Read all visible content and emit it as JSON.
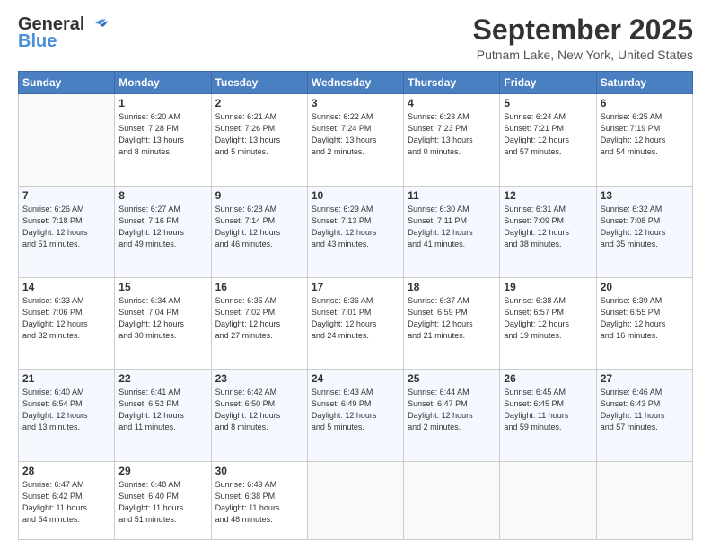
{
  "header": {
    "logo_general": "General",
    "logo_blue": "Blue",
    "month_title": "September 2025",
    "location": "Putnam Lake, New York, United States"
  },
  "weekdays": [
    "Sunday",
    "Monday",
    "Tuesday",
    "Wednesday",
    "Thursday",
    "Friday",
    "Saturday"
  ],
  "weeks": [
    [
      {
        "day": "",
        "info": ""
      },
      {
        "day": "1",
        "info": "Sunrise: 6:20 AM\nSunset: 7:28 PM\nDaylight: 13 hours\nand 8 minutes."
      },
      {
        "day": "2",
        "info": "Sunrise: 6:21 AM\nSunset: 7:26 PM\nDaylight: 13 hours\nand 5 minutes."
      },
      {
        "day": "3",
        "info": "Sunrise: 6:22 AM\nSunset: 7:24 PM\nDaylight: 13 hours\nand 2 minutes."
      },
      {
        "day": "4",
        "info": "Sunrise: 6:23 AM\nSunset: 7:23 PM\nDaylight: 13 hours\nand 0 minutes."
      },
      {
        "day": "5",
        "info": "Sunrise: 6:24 AM\nSunset: 7:21 PM\nDaylight: 12 hours\nand 57 minutes."
      },
      {
        "day": "6",
        "info": "Sunrise: 6:25 AM\nSunset: 7:19 PM\nDaylight: 12 hours\nand 54 minutes."
      }
    ],
    [
      {
        "day": "7",
        "info": "Sunrise: 6:26 AM\nSunset: 7:18 PM\nDaylight: 12 hours\nand 51 minutes."
      },
      {
        "day": "8",
        "info": "Sunrise: 6:27 AM\nSunset: 7:16 PM\nDaylight: 12 hours\nand 49 minutes."
      },
      {
        "day": "9",
        "info": "Sunrise: 6:28 AM\nSunset: 7:14 PM\nDaylight: 12 hours\nand 46 minutes."
      },
      {
        "day": "10",
        "info": "Sunrise: 6:29 AM\nSunset: 7:13 PM\nDaylight: 12 hours\nand 43 minutes."
      },
      {
        "day": "11",
        "info": "Sunrise: 6:30 AM\nSunset: 7:11 PM\nDaylight: 12 hours\nand 41 minutes."
      },
      {
        "day": "12",
        "info": "Sunrise: 6:31 AM\nSunset: 7:09 PM\nDaylight: 12 hours\nand 38 minutes."
      },
      {
        "day": "13",
        "info": "Sunrise: 6:32 AM\nSunset: 7:08 PM\nDaylight: 12 hours\nand 35 minutes."
      }
    ],
    [
      {
        "day": "14",
        "info": "Sunrise: 6:33 AM\nSunset: 7:06 PM\nDaylight: 12 hours\nand 32 minutes."
      },
      {
        "day": "15",
        "info": "Sunrise: 6:34 AM\nSunset: 7:04 PM\nDaylight: 12 hours\nand 30 minutes."
      },
      {
        "day": "16",
        "info": "Sunrise: 6:35 AM\nSunset: 7:02 PM\nDaylight: 12 hours\nand 27 minutes."
      },
      {
        "day": "17",
        "info": "Sunrise: 6:36 AM\nSunset: 7:01 PM\nDaylight: 12 hours\nand 24 minutes."
      },
      {
        "day": "18",
        "info": "Sunrise: 6:37 AM\nSunset: 6:59 PM\nDaylight: 12 hours\nand 21 minutes."
      },
      {
        "day": "19",
        "info": "Sunrise: 6:38 AM\nSunset: 6:57 PM\nDaylight: 12 hours\nand 19 minutes."
      },
      {
        "day": "20",
        "info": "Sunrise: 6:39 AM\nSunset: 6:55 PM\nDaylight: 12 hours\nand 16 minutes."
      }
    ],
    [
      {
        "day": "21",
        "info": "Sunrise: 6:40 AM\nSunset: 6:54 PM\nDaylight: 12 hours\nand 13 minutes."
      },
      {
        "day": "22",
        "info": "Sunrise: 6:41 AM\nSunset: 6:52 PM\nDaylight: 12 hours\nand 11 minutes."
      },
      {
        "day": "23",
        "info": "Sunrise: 6:42 AM\nSunset: 6:50 PM\nDaylight: 12 hours\nand 8 minutes."
      },
      {
        "day": "24",
        "info": "Sunrise: 6:43 AM\nSunset: 6:49 PM\nDaylight: 12 hours\nand 5 minutes."
      },
      {
        "day": "25",
        "info": "Sunrise: 6:44 AM\nSunset: 6:47 PM\nDaylight: 12 hours\nand 2 minutes."
      },
      {
        "day": "26",
        "info": "Sunrise: 6:45 AM\nSunset: 6:45 PM\nDaylight: 11 hours\nand 59 minutes."
      },
      {
        "day": "27",
        "info": "Sunrise: 6:46 AM\nSunset: 6:43 PM\nDaylight: 11 hours\nand 57 minutes."
      }
    ],
    [
      {
        "day": "28",
        "info": "Sunrise: 6:47 AM\nSunset: 6:42 PM\nDaylight: 11 hours\nand 54 minutes."
      },
      {
        "day": "29",
        "info": "Sunrise: 6:48 AM\nSunset: 6:40 PM\nDaylight: 11 hours\nand 51 minutes."
      },
      {
        "day": "30",
        "info": "Sunrise: 6:49 AM\nSunset: 6:38 PM\nDaylight: 11 hours\nand 48 minutes."
      },
      {
        "day": "",
        "info": ""
      },
      {
        "day": "",
        "info": ""
      },
      {
        "day": "",
        "info": ""
      },
      {
        "day": "",
        "info": ""
      }
    ]
  ]
}
